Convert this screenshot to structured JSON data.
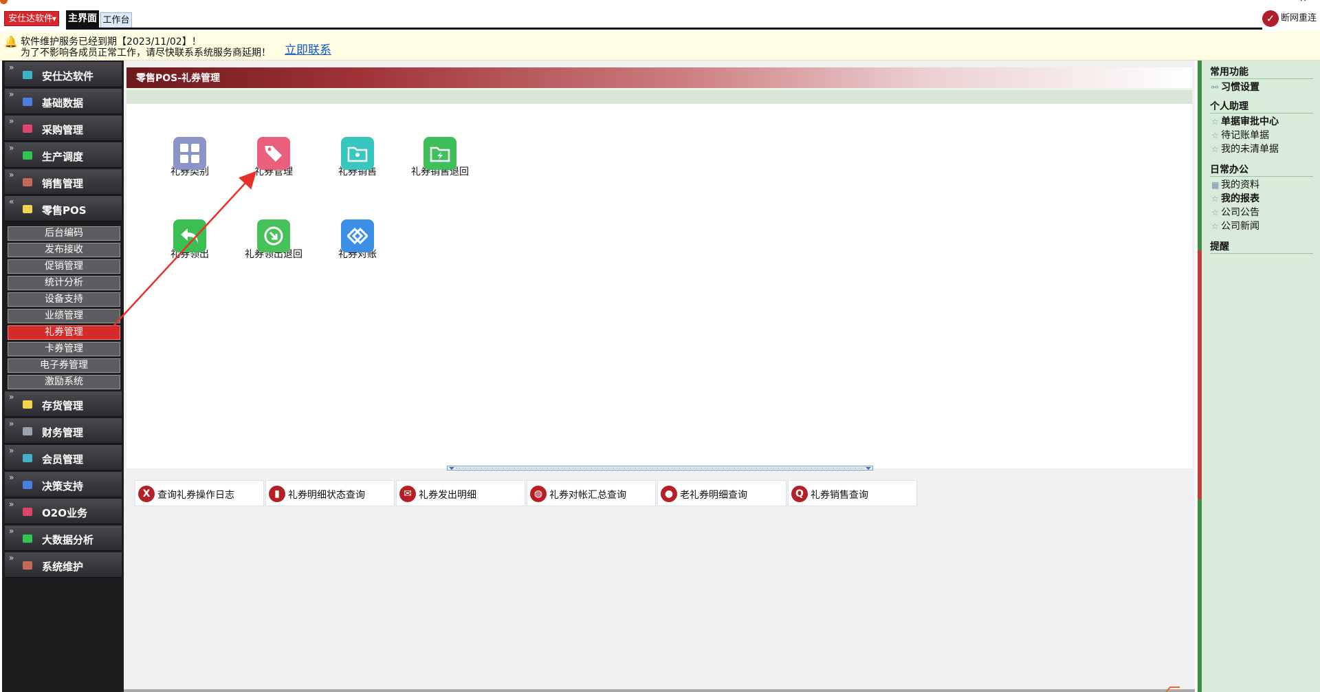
{
  "window": {
    "title": "",
    "controls": [
      "–",
      "×"
    ]
  },
  "topbar": {
    "brand": "安仕达软件",
    "tabs": [
      "主界面",
      "工作台"
    ],
    "net_status": "断网重连"
  },
  "notice": {
    "line1": "软件维护服务已经到期【2023/11/02】！",
    "line2": "为了不影响各成员正常工作，请尽快联系系统服务商延期！",
    "link": "立即联系"
  },
  "sidebar": {
    "items": [
      {
        "label": "安仕达软件",
        "color": "#3fb4c9"
      },
      {
        "label": "基础数据",
        "color": "#4a7fe0"
      },
      {
        "label": "采购管理",
        "color": "#e0446b"
      },
      {
        "label": "生产调度",
        "color": "#2fc64f"
      },
      {
        "label": "销售管理",
        "color": "#c46a5a"
      },
      {
        "label": "零售POS",
        "color": "#f2d54a"
      }
    ],
    "subitems": [
      "后台编码",
      "发布接收",
      "促销管理",
      "统计分析",
      "设备支持",
      "业绩管理",
      "礼券管理",
      "卡券管理",
      "电子券管理",
      "激励系统"
    ],
    "active_subitem": "礼券管理",
    "items_after": [
      {
        "label": "存货管理",
        "color": "#f2d54a"
      },
      {
        "label": "财务管理",
        "color": "#9aa3b0"
      },
      {
        "label": "会员管理",
        "color": "#3fb4c9"
      },
      {
        "label": "决策支持",
        "color": "#4a7fe0"
      },
      {
        "label": "O2O业务",
        "color": "#e0446b"
      },
      {
        "label": "大数据分析",
        "color": "#2fc64f"
      },
      {
        "label": "系统维护",
        "color": "#c46a5a"
      }
    ]
  },
  "main": {
    "header": "零售POS-礼券管理",
    "tiles": [
      {
        "label": "礼券类别",
        "color": "#8b94c8",
        "icon": "grid-icon"
      },
      {
        "label": "礼券管理",
        "color": "#e8607c",
        "icon": "tag-icon"
      },
      {
        "label": "礼券销售",
        "color": "#38c6c0",
        "icon": "folder-icon"
      },
      {
        "label": "礼券销售退回",
        "color": "#3fbf5c",
        "icon": "folder-return-icon"
      },
      {
        "label": "礼券领出",
        "color": "#3cbf52",
        "icon": "return-arrow-icon"
      },
      {
        "label": "礼券领出退回",
        "color": "#47c25a",
        "icon": "circle-arrow-icon"
      },
      {
        "label": "礼券对账",
        "color": "#3c8fe6",
        "icon": "diamond-link-icon"
      }
    ],
    "reports": [
      {
        "label": "查询礼券操作日志",
        "icon": "x-circle-icon",
        "glyph": "X"
      },
      {
        "label": "礼券明细状态查询",
        "icon": "bar-chart-icon",
        "glyph": "▮"
      },
      {
        "label": "礼券发出明细",
        "icon": "mail-icon",
        "glyph": "✉"
      },
      {
        "label": "礼券对帐汇总查询",
        "icon": "globe-icon",
        "glyph": "◍"
      },
      {
        "label": "老礼券明细查询",
        "icon": "person-icon",
        "glyph": "●"
      },
      {
        "label": "礼券销售查询",
        "icon": "search-icon",
        "glyph": "Q"
      }
    ]
  },
  "rightpanel": {
    "sections": [
      {
        "title": "常用功能",
        "items": [
          {
            "label": "习惯设置",
            "bold": true,
            "icon": "link-icon"
          }
        ]
      },
      {
        "title": "个人助理",
        "items": [
          {
            "label": "单据审批中心",
            "bold": true,
            "icon": "star-icon"
          },
          {
            "label": "待记账单据",
            "bold": false,
            "icon": "star-icon"
          },
          {
            "label": "我的未清单据",
            "bold": false,
            "icon": "star-icon"
          }
        ]
      },
      {
        "title": "日常办公",
        "items": [
          {
            "label": "我的资料",
            "bold": false,
            "icon": "calendar-icon"
          },
          {
            "label": "我的报表",
            "bold": true,
            "icon": "star-icon"
          },
          {
            "label": "公司公告",
            "bold": false,
            "icon": "star-icon"
          },
          {
            "label": "公司新闻",
            "bold": false,
            "icon": "star-icon"
          }
        ]
      },
      {
        "title": "提醒",
        "items": []
      }
    ]
  },
  "colors": {
    "accent_red": "#d42a2a",
    "header_dark": "#6d1a1d",
    "sidebar_bg": "#1d1d1f",
    "right_panel_bg": "#d8ecd9",
    "annotation_arrow": "#e8312a"
  }
}
